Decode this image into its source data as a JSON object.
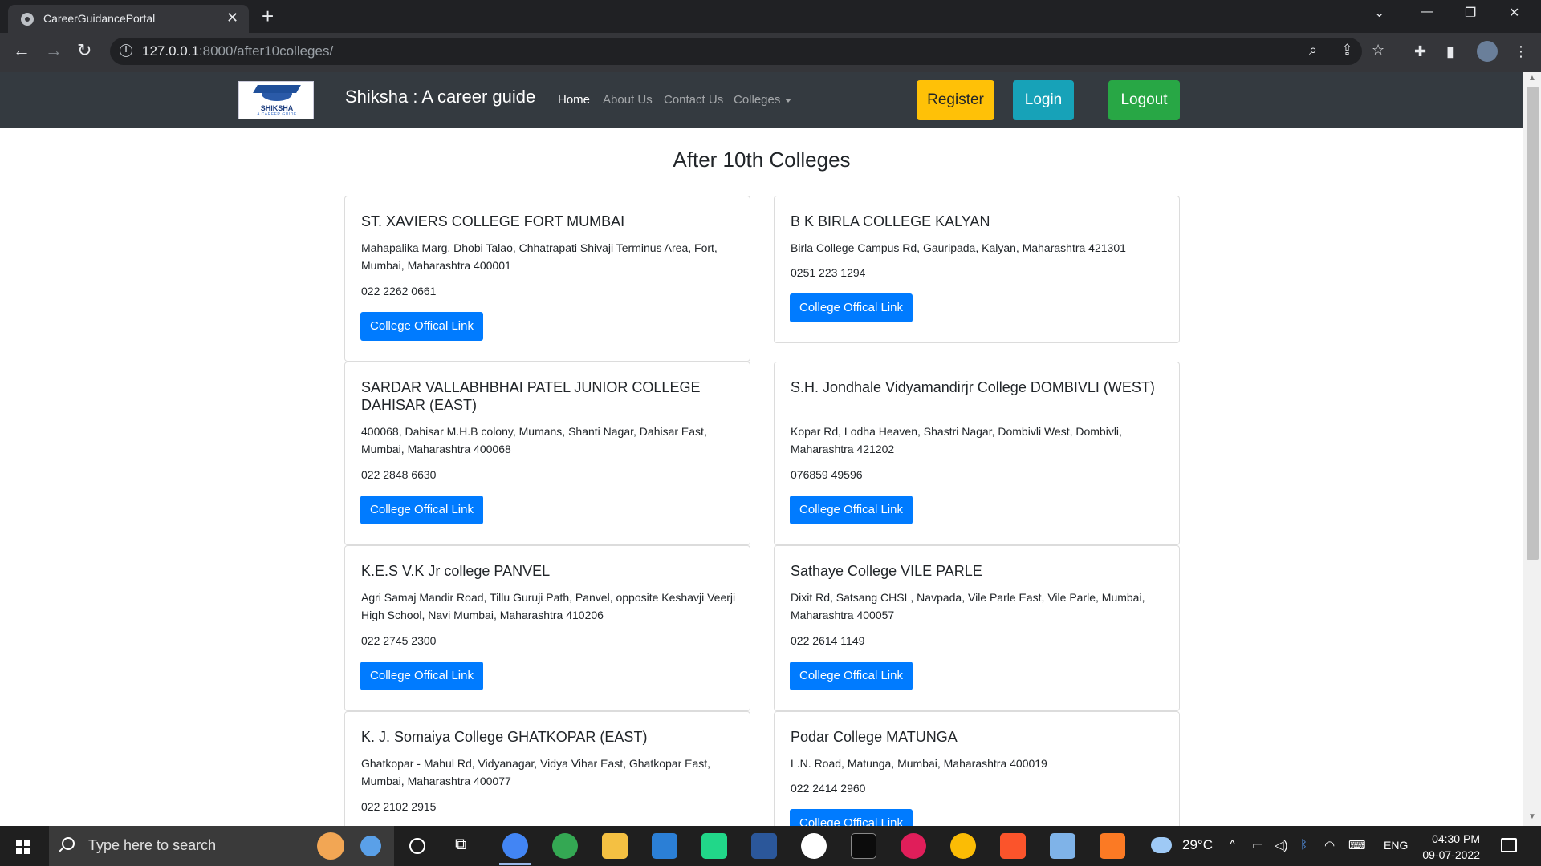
{
  "browser": {
    "tab_title": "CareerGuidancePortal",
    "url_host": "127.0.0.1",
    "url_path": ":8000/after10colleges/"
  },
  "navbar": {
    "brand": "Shiksha : A career guide",
    "logo_text": "SHIKSHA",
    "logo_subtext": "A CAREER GUIDE",
    "links": [
      "Home",
      "About Us",
      "Contact Us",
      "Colleges"
    ],
    "register": "Register",
    "login": "Login",
    "logout": "Logout"
  },
  "main": {
    "title": "After 10th Colleges",
    "button_label": "College Offical Link",
    "colleges": [
      {
        "name": "ST. XAVIERS COLLEGE FORT MUMBAI",
        "address": "Mahapalika Marg, Dhobi Talao, Chhatrapati Shivaji Terminus Area, Fort, Mumbai, Maharashtra 400001",
        "phone": "022 2262 0661"
      },
      {
        "name": "B K BIRLA COLLEGE KALYAN",
        "address": "Birla College Campus Rd, Gauripada, Kalyan, Maharashtra 421301",
        "phone": "0251 223 1294"
      },
      {
        "name": "SARDAR VALLABHBHAI PATEL JUNIOR COLLEGE DAHISAR (EAST)",
        "address": "400068, Dahisar M.H.B colony, Mumans, Shanti Nagar, Dahisar East, Mumbai, Maharashtra 400068",
        "phone": "022 2848 6630"
      },
      {
        "name": "S.H. Jondhale Vidyamandirjr College DOMBIVLI (WEST)",
        "address": "Kopar Rd, Lodha Heaven, Shastri Nagar, Dombivli West, Dombivli, Maharashtra 421202",
        "phone": "076859 49596"
      },
      {
        "name": "K.E.S V.K Jr college PANVEL",
        "address": "Agri Samaj Mandir Road, Tillu Guruji Path, Panvel, opposite Keshavji Veerji High School, Navi Mumbai, Maharashtra 410206",
        "phone": "022 2745 2300"
      },
      {
        "name": "Sathaye College VILE PARLE",
        "address": "Dixit Rd, Satsang CHSL, Navpada, Vile Parle East, Vile Parle, Mumbai, Maharashtra 400057",
        "phone": "022 2614 1149"
      },
      {
        "name": "K. J. Somaiya College GHATKOPAR (EAST)",
        "address": "Ghatkopar - Mahul Rd, Vidyanagar, Vidya Vihar East, Ghatkopar East, Mumbai, Maharashtra 400077",
        "phone": "022 2102 2915"
      },
      {
        "name": "Podar College MATUNGA",
        "address": "L.N. Road, Matunga, Mumbai, Maharashtra 400019",
        "phone": "022 2414 2960"
      }
    ]
  },
  "taskbar": {
    "search_placeholder": "Type here to search",
    "weather": "29°C",
    "language": "ENG",
    "time": "04:30 PM",
    "date": "09-07-2022"
  },
  "colors": {
    "navbar_bg": "#343a40",
    "primary": "#007bff",
    "warning": "#ffc107",
    "info": "#17a2b8",
    "success": "#28a745"
  }
}
